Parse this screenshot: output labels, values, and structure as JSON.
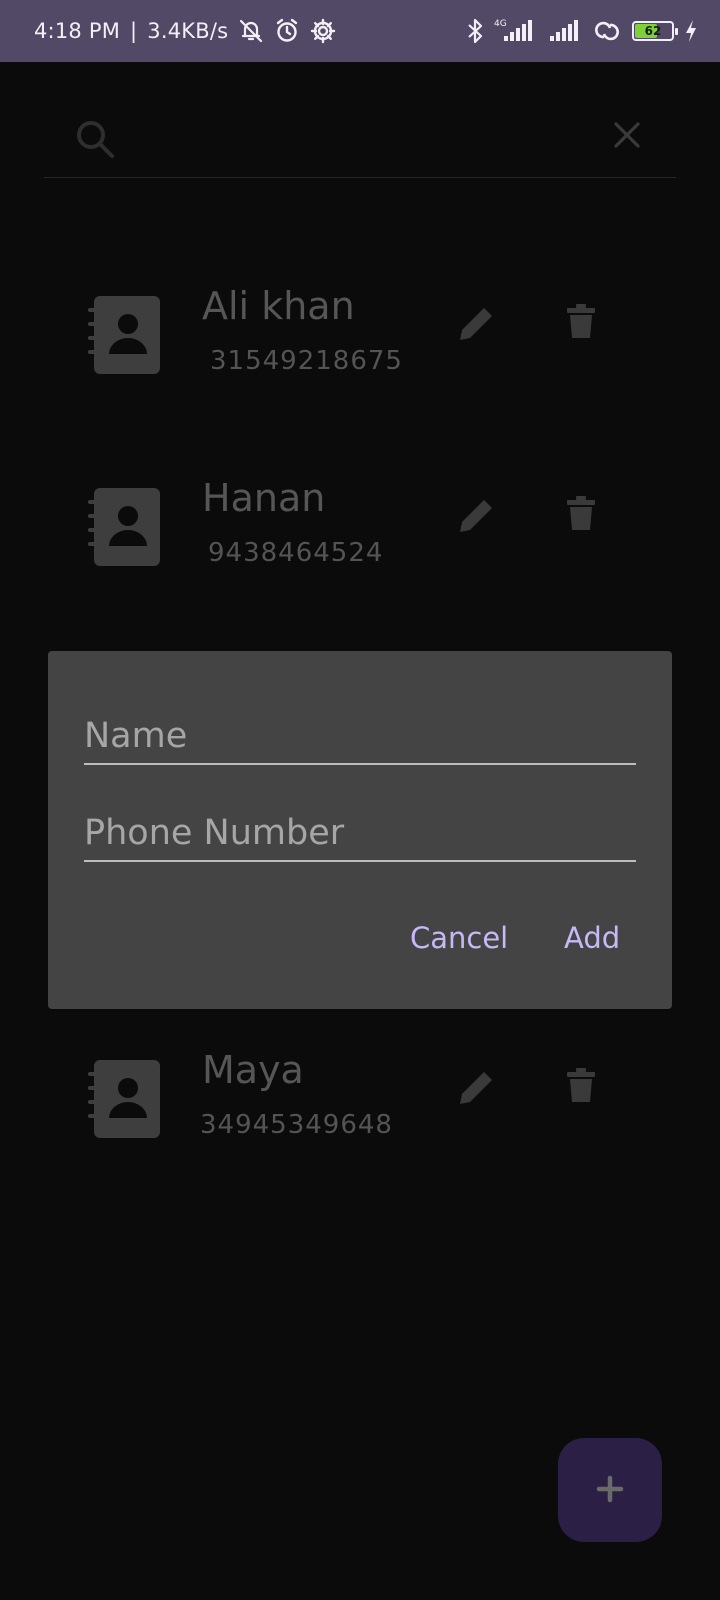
{
  "status_bar": {
    "time": "4:18 PM",
    "separator": "|",
    "net_speed": "3.4KB/s",
    "network_type": "4G",
    "battery_level": "62",
    "battery_fraction": 0.62,
    "icons": [
      "mute-icon",
      "alarm-icon",
      "settings-icon",
      "bluetooth-icon",
      "signal-icon",
      "hotspot-icon",
      "battery-icon",
      "charging-icon"
    ]
  },
  "search": {
    "placeholder": "",
    "value": ""
  },
  "contacts": [
    {
      "name": "Ali khan",
      "phone": "31549218675"
    },
    {
      "name": "Hanan",
      "phone": "9438464524"
    },
    {
      "name": "Maya",
      "phone": "34945349648"
    }
  ],
  "dialog": {
    "name_placeholder": "Name",
    "phone_placeholder": "Phone Number",
    "cancel_label": "Cancel",
    "add_label": "Add"
  },
  "fab": {
    "symbol": "+"
  },
  "colors": {
    "status_bar": "#514965",
    "background": "#0b0b0b",
    "dialog": "#444444",
    "accent": "#c7b8f6",
    "fab": "#2b1f45"
  }
}
